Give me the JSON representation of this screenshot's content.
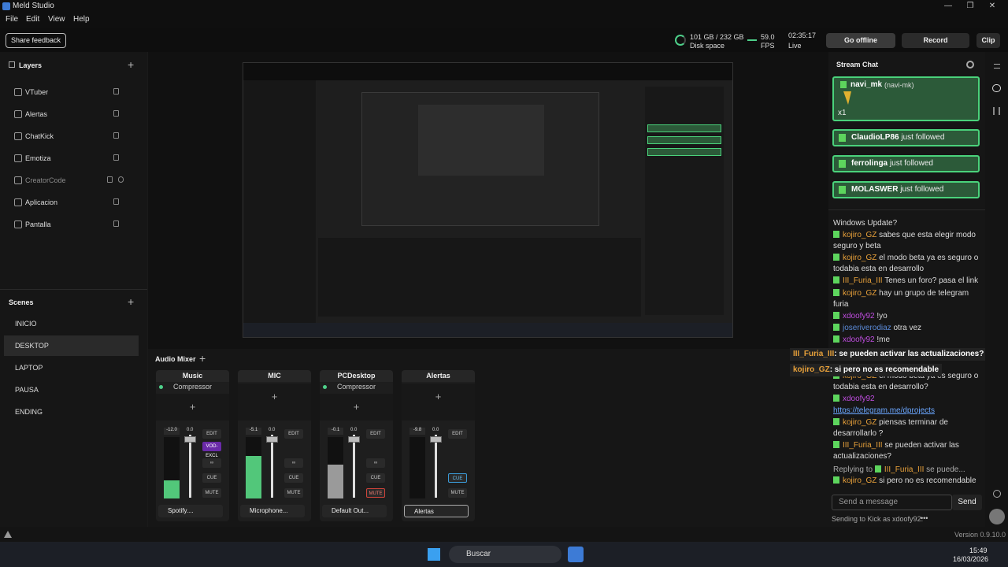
{
  "window": {
    "title": "Meld Studio",
    "minimize": "—",
    "maximize": "❐",
    "close": "✕"
  },
  "menu": {
    "file": "File",
    "edit": "Edit",
    "view": "View",
    "help": "Help"
  },
  "toolbar": {
    "share_feedback": "Share feedback",
    "disk_value": "101 GB / 232 GB",
    "disk_label": "Disk space",
    "fps_value": "59.0",
    "fps_label": "FPS",
    "time_value": "02:35:17",
    "time_label": "Live",
    "go_offline": "Go offline",
    "record": "Record",
    "clip": "Clip"
  },
  "layers": {
    "title": "Layers",
    "add": "+",
    "items": [
      {
        "label": "VTuber"
      },
      {
        "label": "Alertas"
      },
      {
        "label": "ChatKick"
      },
      {
        "label": "Emotiza"
      },
      {
        "label": "CreatorCode"
      },
      {
        "label": "Aplicacion"
      },
      {
        "label": "Pantalla"
      }
    ]
  },
  "scenes": {
    "title": "Scenes",
    "add": "+",
    "items": [
      {
        "label": "INICIO"
      },
      {
        "label": "DESKTOP"
      },
      {
        "label": "LAPTOP"
      },
      {
        "label": "PAUSA"
      },
      {
        "label": "ENDING"
      }
    ],
    "selected": "DESKTOP"
  },
  "audio": {
    "title": "Audio Mixer",
    "add": "+",
    "add_effect": "+",
    "edit": "EDIT",
    "cue": "CUE",
    "mute": "MUTE",
    "vod_excl": "VOD-EXCL",
    "channels": [
      {
        "name": "Music",
        "compressor": "Compressor",
        "db": "-12.0",
        "gain": "0.0",
        "source": "Spotify....",
        "level": 0.3
      },
      {
        "name": "MIC",
        "compressor": "",
        "db": "-5.1",
        "gain": "0.0",
        "source": "Microphone...",
        "level": 0.7
      },
      {
        "name": "PCDesktop",
        "compressor": "Compressor",
        "db": "-0.1",
        "gain": "0.0",
        "source": "Default Out...",
        "level": 0.55
      },
      {
        "name": "Alertas",
        "compressor": "",
        "db": "-9.8",
        "gain": "0.0",
        "source": "Alertas",
        "level": 0.0
      }
    ]
  },
  "chat": {
    "title": "Stream Chat",
    "donation": {
      "name": "navi_mk",
      "handle": "(navi-mk)",
      "count": "x1"
    },
    "alerts": [
      {
        "name": "ClaudioLP86",
        "text": "just followed"
      },
      {
        "name": "ferrolinga",
        "text": "just followed"
      },
      {
        "name": "MOLASWER",
        "text": "just followed"
      }
    ],
    "messages": [
      {
        "user": "",
        "text": "Windows Update?"
      },
      {
        "user": "kojiro_GZ",
        "text": "sabes que esta elegir modo seguro y beta"
      },
      {
        "user": "kojiro_GZ",
        "text": "el modo beta ya es seguro o todabia esta en desarrollo"
      },
      {
        "user": "III_Furia_III",
        "text": "Tenes un foro? pasa el link"
      },
      {
        "user": "kojiro_GZ",
        "text": "hay un grupo de telegram furia"
      },
      {
        "user": "xdoofy92",
        "text": "!yo"
      },
      {
        "user": "joseriverodiaz",
        "text": "otra vez"
      },
      {
        "user": "xdoofy92",
        "text": "!me"
      },
      {
        "user": "kojiro_GZ",
        "text": "el modo beta ya es seguro o todabia esta en desarrollo?"
      },
      {
        "user": "xdoofy92",
        "text": ""
      },
      {
        "user": "",
        "text": "https://telegram.me/dprojects"
      },
      {
        "user": "kojiro_GZ",
        "text": "piensas terminar de desarrollarlo ?"
      },
      {
        "user": "III_Furia_III",
        "text": "se pueden activar las actualizaciones?"
      },
      {
        "user": "kojiro_GZ",
        "text": "si pero no es recomendable"
      }
    ],
    "reply_prefix": "Replying to",
    "reply_user": "III_Furia_III",
    "reply_text": "se puede...",
    "send_placeholder": "Send a message",
    "send": "Send",
    "sending_as": "Sending to Kick as xdoofy92.",
    "more": "•••"
  },
  "overlay": [
    {
      "user": "III_Furia_III",
      "text": ": se pueden activar las actualizaciones?"
    },
    {
      "user": "kojiro_GZ",
      "text": ": si pero no es recomendable"
    }
  ],
  "status": {
    "version": "Version 0.9.10.0"
  },
  "taskbar": {
    "search": "Buscar",
    "time": "15:49",
    "date": "16/03/2026"
  },
  "colors": {
    "accent_green": "#4ad27b",
    "offline_btn": "#2b2b2b",
    "username": "#e8a13a"
  }
}
